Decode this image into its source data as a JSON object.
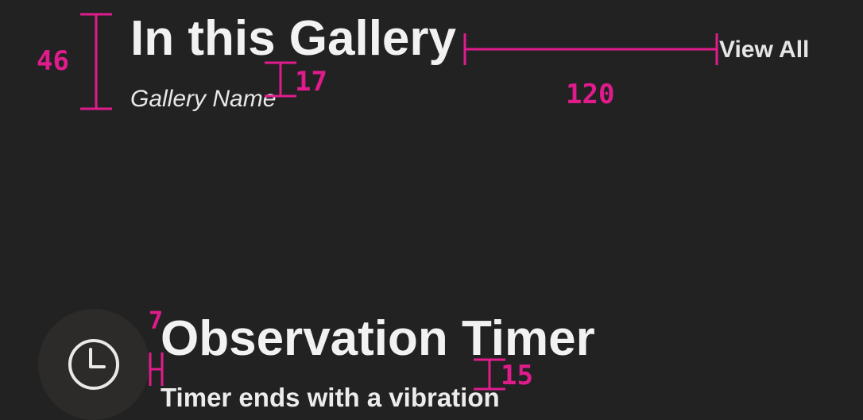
{
  "gallery": {
    "title": "In this Gallery",
    "name": "Gallery Name",
    "view_all_label": "View All"
  },
  "timer": {
    "icon": "clock-icon",
    "title": "Observation Timer",
    "subtitle": "Timer ends with a vibration"
  },
  "redlines": {
    "color": "#e01c8c",
    "labels": {
      "header_height": "46",
      "title_name_gap": "17",
      "title_viewall_gap": "120",
      "icon_title_gap": "7",
      "title_subtitle_gap": "15"
    }
  },
  "colors": {
    "background": "#222222",
    "text_primary": "#f2f2f2",
    "icon_circle": "#2c2b29"
  }
}
